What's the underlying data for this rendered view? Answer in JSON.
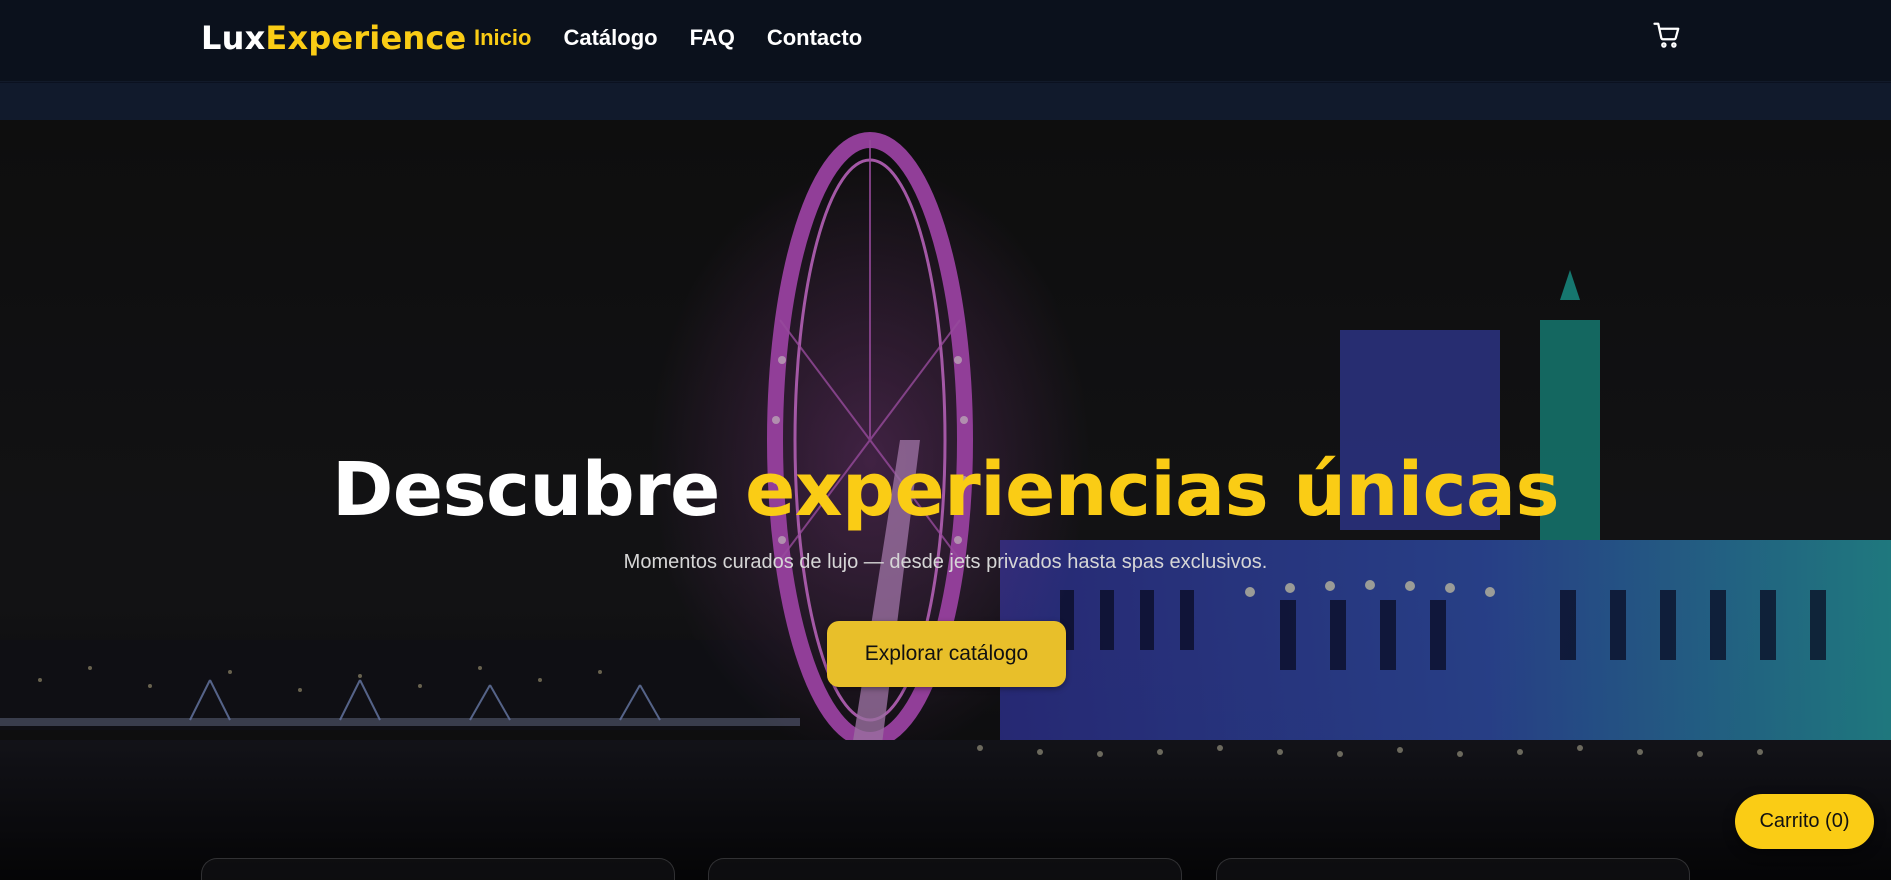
{
  "brand": {
    "part1": "Lux",
    "part2": "Experience"
  },
  "nav": {
    "items": [
      {
        "label": "Inicio",
        "active": true
      },
      {
        "label": "Catálogo",
        "active": false
      },
      {
        "label": "FAQ",
        "active": false
      },
      {
        "label": "Contacto",
        "active": false
      }
    ]
  },
  "header": {
    "cart_icon": "shopping-cart-icon"
  },
  "hero": {
    "title_plain": "Descubre",
    "title_highlight": "experiencias únicas",
    "subtitle": "Momentos curados de lujo — desde jets privados hasta spas exclusivos.",
    "cta_label": "Explorar catálogo",
    "background": "night-city-ferris-wheel-image"
  },
  "floating_cart": {
    "label": "Carrito (0)"
  },
  "colors": {
    "accent": "#facc15",
    "header_bg": "#0b111c",
    "subbar_bg": "#111a2c",
    "text_light": "#ffffff"
  }
}
